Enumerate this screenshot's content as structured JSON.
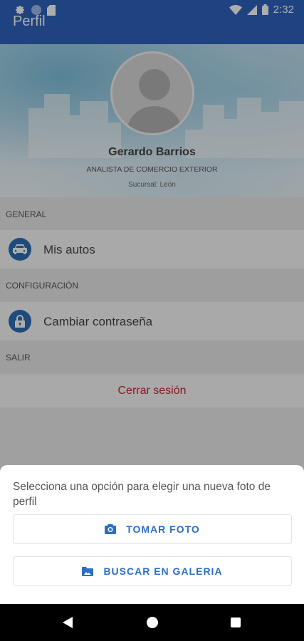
{
  "status_bar": {
    "time": "2:32"
  },
  "app_bar": {
    "title": "Perfil"
  },
  "profile": {
    "name": "Gerardo Barrios",
    "role": "ANALISTA DE COMERCIO EXTERIOR",
    "branch": "Sucursal: León"
  },
  "sections": {
    "general": {
      "header": "GENERAL",
      "item": "Mis autos"
    },
    "config": {
      "header": "CONFIGURACIÓN",
      "item": "Cambiar contraseña"
    },
    "exit": {
      "header": "SALIR",
      "item": "Cerrar sesión"
    }
  },
  "sheet": {
    "prompt": "Selecciona una opción para elegir una nueva foto de perfil",
    "take_photo": "TOMAR FOTO",
    "gallery": "BUSCAR EN GALERIA"
  },
  "colors": {
    "primary": "#2f63bf",
    "accent": "#2c6fc4",
    "logout": "#c62828"
  },
  "icons": [
    "settings-icon",
    "circle-notification-icon",
    "sd-card-icon",
    "wifi-icon",
    "signal-icon",
    "battery-icon",
    "car-icon",
    "lock-icon",
    "camera-icon",
    "folder-image-icon",
    "back-icon",
    "home-icon",
    "recents-icon"
  ]
}
